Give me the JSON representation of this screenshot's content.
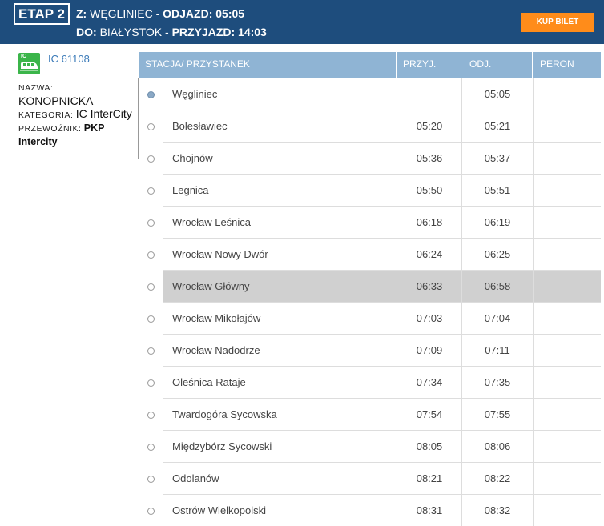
{
  "header": {
    "etap": "ETAP 2",
    "from_label": "Z:",
    "from_station": "WĘGLINIEC",
    "departure_label": "ODJAZD:",
    "departure_time": "05:05",
    "to_label": "DO:",
    "to_station": "BIAŁYSTOK",
    "arrival_label": "PRZYJAZD:",
    "arrival_time": "14:03",
    "buy_button": "KUP BILET",
    "separator": "-"
  },
  "train": {
    "icon": "intercity-train-icon",
    "badge_text": "IC",
    "number": "IC 61108",
    "name_label": "NAZWA:",
    "name": "KONOPNICKA",
    "category_label": "KATEGORIA:",
    "category": "IC InterCity",
    "carrier_label": "PRZEWOŹNIK:",
    "carrier": "PKP Intercity"
  },
  "table": {
    "headers": {
      "station": "STACJA/ PRZYSTANEK",
      "arrival": "PRZYJ.",
      "departure": "ODJ.",
      "platform": "PERON"
    },
    "rows": [
      {
        "station": "Węgliniec",
        "arrival": "",
        "departure": "05:05",
        "platform": ""
      },
      {
        "station": "Bolesławiec",
        "arrival": "05:20",
        "departure": "05:21",
        "platform": ""
      },
      {
        "station": "Chojnów",
        "arrival": "05:36",
        "departure": "05:37",
        "platform": ""
      },
      {
        "station": "Legnica",
        "arrival": "05:50",
        "departure": "05:51",
        "platform": ""
      },
      {
        "station": "Wrocław Leśnica",
        "arrival": "06:18",
        "departure": "06:19",
        "platform": ""
      },
      {
        "station": "Wrocław Nowy Dwór",
        "arrival": "06:24",
        "departure": "06:25",
        "platform": ""
      },
      {
        "station": "Wrocław Główny",
        "arrival": "06:33",
        "departure": "06:58",
        "platform": ""
      },
      {
        "station": "Wrocław Mikołajów",
        "arrival": "07:03",
        "departure": "07:04",
        "platform": ""
      },
      {
        "station": "Wrocław Nadodrze",
        "arrival": "07:09",
        "departure": "07:11",
        "platform": ""
      },
      {
        "station": "Oleśnica Rataje",
        "arrival": "07:34",
        "departure": "07:35",
        "platform": ""
      },
      {
        "station": "Twardogóra Sycowska",
        "arrival": "07:54",
        "departure": "07:55",
        "platform": ""
      },
      {
        "station": "Międzybórz Sycowski",
        "arrival": "08:05",
        "departure": "08:06",
        "platform": ""
      },
      {
        "station": "Odolanów",
        "arrival": "08:21",
        "departure": "08:22",
        "platform": ""
      },
      {
        "station": "Ostrów Wielkopolski",
        "arrival": "08:31",
        "departure": "08:32",
        "platform": ""
      }
    ]
  },
  "colors": {
    "header_bg": "#1e4d7d",
    "buy_button_bg": "#ff8c1a",
    "table_header_bg": "#8fb4d4",
    "highlight_row_bg": "#d0d0d0",
    "ic_badge_bg": "#3bb54a",
    "link": "#3a7ab8"
  }
}
